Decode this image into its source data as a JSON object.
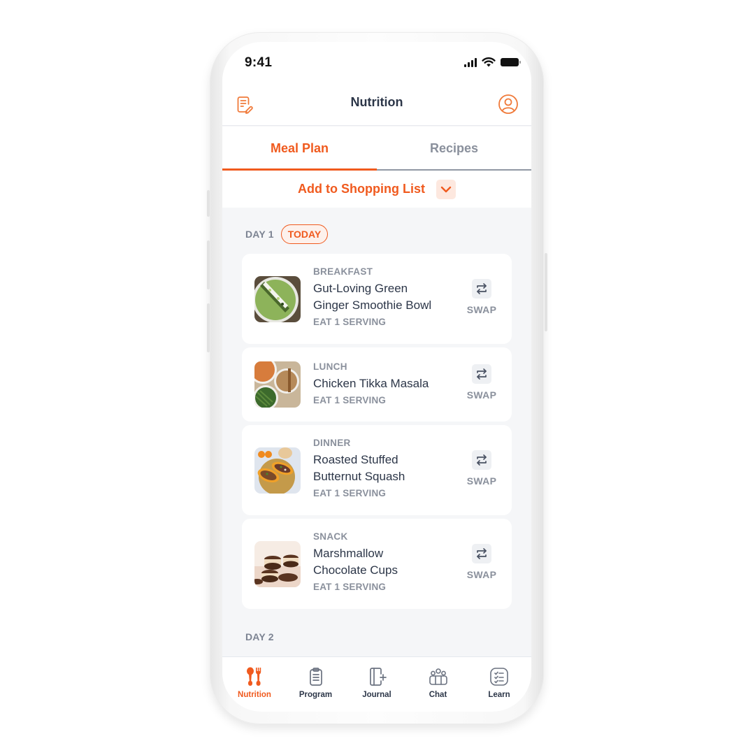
{
  "status_bar": {
    "time": "9:41",
    "icons": [
      "cellular-signal-icon",
      "wifi-icon",
      "battery-icon"
    ]
  },
  "header": {
    "title": "Nutrition",
    "left_icon": "document-edit-icon",
    "right_icon": "user-profile-icon"
  },
  "tabs": [
    {
      "label": "Meal Plan",
      "active": true
    },
    {
      "label": "Recipes",
      "active": false
    }
  ],
  "shopping_list": {
    "label": "Add to Shopping List",
    "icon": "chevron-down-icon"
  },
  "days": [
    {
      "label": "DAY 1",
      "badge": "TODAY",
      "meals": [
        {
          "type": "BREAKFAST",
          "name_line1": "Gut-Loving Green",
          "name_line2": "Ginger Smoothie Bowl",
          "serving": "EAT 1 SERVING",
          "swap_label": "SWAP",
          "image": "green-smoothie-bowl"
        },
        {
          "type": "LUNCH",
          "name_line1": "Chicken Tikka Masala",
          "name_line2": "",
          "serving": "EAT 1 SERVING",
          "swap_label": "SWAP",
          "image": "chicken-tikka-masala"
        },
        {
          "type": "DINNER",
          "name_line1": "Roasted Stuffed",
          "name_line2": "Butternut Squash",
          "serving": "EAT 1 SERVING",
          "swap_label": "SWAP",
          "image": "stuffed-butternut-squash"
        },
        {
          "type": "SNACK",
          "name_line1": "Marshmallow",
          "name_line2": "Chocolate Cups",
          "serving": "EAT 1 SERVING",
          "swap_label": "SWAP",
          "image": "chocolate-cups"
        }
      ]
    },
    {
      "label": "DAY 2",
      "badge": "",
      "meals": []
    }
  ],
  "bottom_nav": [
    {
      "label": "Nutrition",
      "icon": "fork-spoon-icon",
      "active": true
    },
    {
      "label": "Program",
      "icon": "clipboard-icon",
      "active": false
    },
    {
      "label": "Journal",
      "icon": "journal-add-icon",
      "active": false
    },
    {
      "label": "Chat",
      "icon": "group-chat-icon",
      "active": false
    },
    {
      "label": "Learn",
      "icon": "checklist-icon",
      "active": false
    }
  ],
  "colors": {
    "accent": "#f05a1e",
    "text_primary": "#2c3648",
    "text_muted": "#8a909c",
    "background": "#f5f6f8"
  }
}
